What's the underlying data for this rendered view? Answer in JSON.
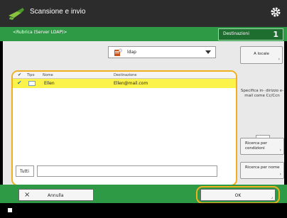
{
  "window": {
    "title": "Scansione e invio"
  },
  "header": {
    "addressbook_tab": "<Rubrica (Server LDAP)>",
    "destination_label": "Destinazioni",
    "destination_count": "1"
  },
  "source": {
    "selected": "ldap"
  },
  "list": {
    "columns": {
      "check": "✔",
      "type": "Tipo",
      "name": "Nome",
      "destination": "Destinazione"
    },
    "rows": [
      {
        "name": "Ellen",
        "destination": "Ellen@mail.com",
        "checked": "✔"
      }
    ]
  },
  "filter": {
    "button_label": "Tutti",
    "value": ""
  },
  "side": {
    "local_button": "A locale",
    "specify_text": "Specifica in- dirizzo e-mail come Cc/Ccn",
    "search_conditions": "Ricerca per condizioni",
    "search_name": "Ricerca per nome"
  },
  "footer": {
    "cancel_label": "Annulla",
    "ok_label": "OK"
  },
  "colors": {
    "green": "#2f9a45",
    "highlight": "#f0b01e",
    "selected_row": "#fbf24a"
  },
  "icons": {
    "app": "scan-send-icon",
    "settings": "gear-icon",
    "source": "ldap-server-icon",
    "cancel": "close-icon"
  }
}
